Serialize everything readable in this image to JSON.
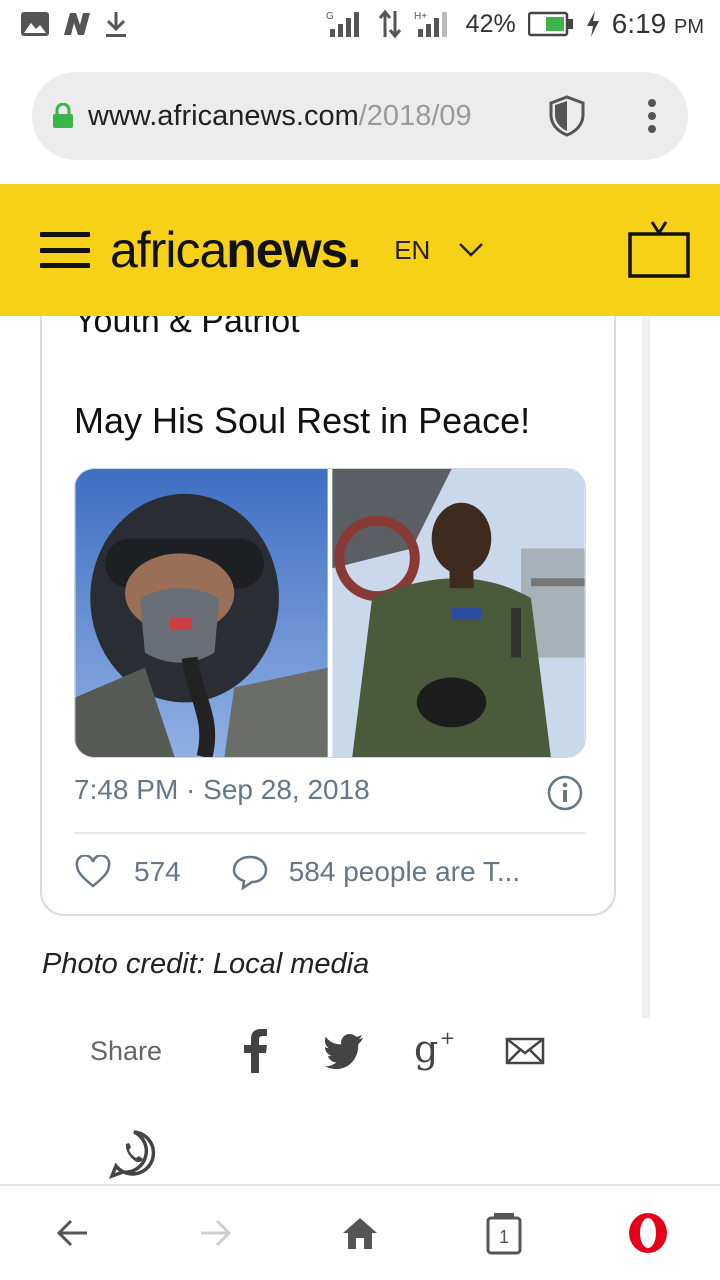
{
  "status_bar": {
    "network_g": "G",
    "network_hplus": "H+",
    "battery": "42%",
    "time": "6:19",
    "ampm": "PM"
  },
  "browser": {
    "url_main": "www.africanews.com",
    "url_dim": "/2018/09"
  },
  "site_header": {
    "logo_light": "africa",
    "logo_bold": "news.",
    "language": "EN"
  },
  "tweet": {
    "partial_text": "Youth & Patriot",
    "text": "May His Soul Rest in Peace!",
    "timestamp": "7:48 PM · Sep 28, 2018",
    "likes": "574",
    "replies_text": "584 people are T..."
  },
  "article": {
    "photo_credit": "Photo credit: Local media"
  },
  "share": {
    "label": "Share",
    "icons": [
      "facebook-icon",
      "twitter-icon",
      "google-plus-icon",
      "email-icon",
      "whatsapp-icon"
    ]
  },
  "bottom_nav": {
    "tab_count": "1"
  },
  "colors": {
    "header_yellow": "#f7d117",
    "opera_red": "#e4001b",
    "tweet_gray": "#657786"
  }
}
